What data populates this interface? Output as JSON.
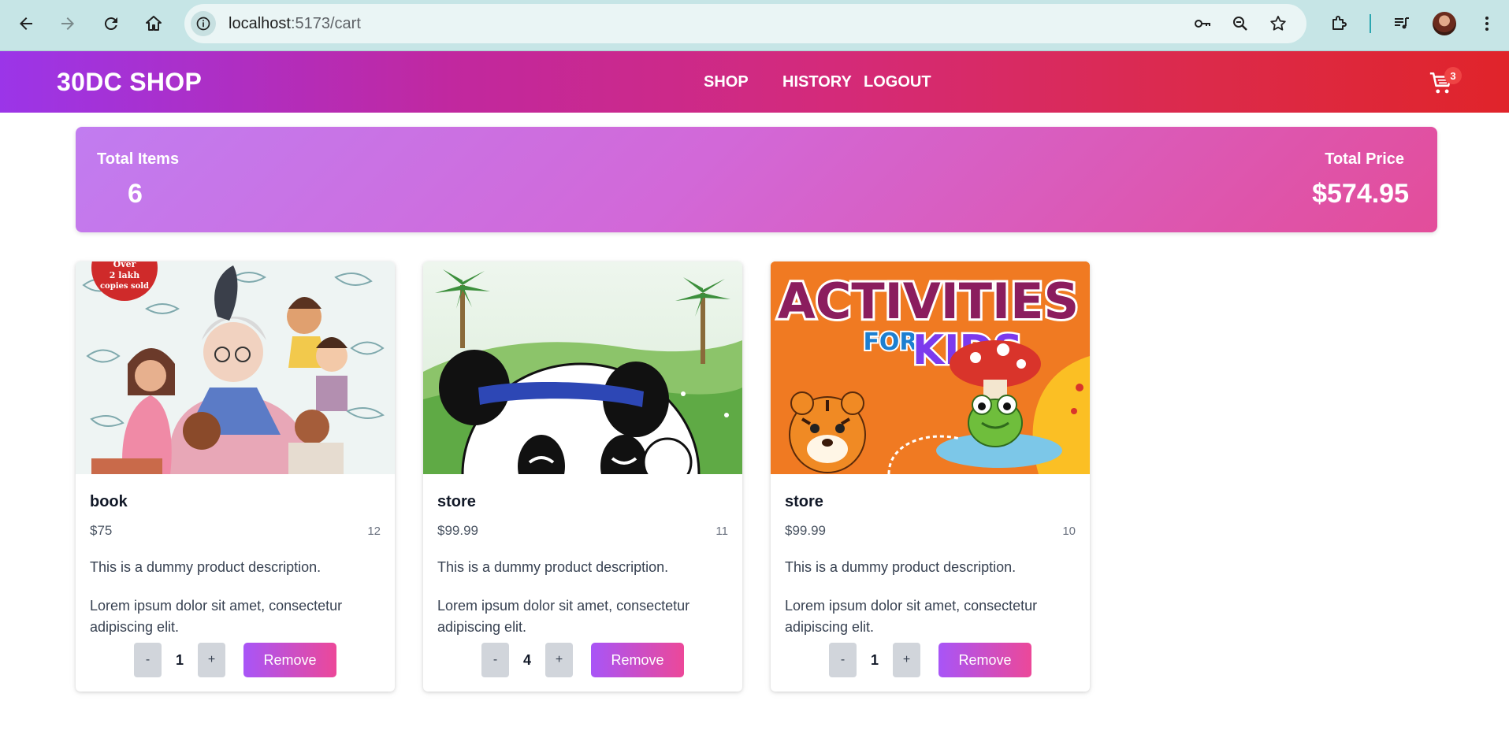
{
  "browser": {
    "url_host": "localhost",
    "url_path": ":5173/cart"
  },
  "header": {
    "brand": "30DC SHOP",
    "nav": [
      {
        "label": "SHOP"
      },
      {
        "label": "HISTORY"
      },
      {
        "label": "LOGOUT"
      }
    ],
    "cart_count": "3"
  },
  "summary": {
    "total_items_label": "Total Items",
    "total_items": "6",
    "total_price_label": "Total Price",
    "total_price": "$574.95"
  },
  "products": [
    {
      "name": "book",
      "price": "$75",
      "stock": "12",
      "description": "This is a dummy product description.",
      "lorem": "Lorem ipsum dolor sit amet, consectetur adipiscing elit.",
      "quantity": "1",
      "minus": "-",
      "plus": "+",
      "remove": "Remove",
      "badge_line1": "Over",
      "badge_line2": "2 lakh",
      "badge_line3": "copies sold"
    },
    {
      "name": "store",
      "price": "$99.99",
      "stock": "11",
      "description": "This is a dummy product description.",
      "lorem": "Lorem ipsum dolor sit amet, consectetur adipiscing elit.",
      "quantity": "4",
      "minus": "-",
      "plus": "+",
      "remove": "Remove"
    },
    {
      "name": "store",
      "price": "$99.99",
      "stock": "10",
      "description": "This is a dummy product description.",
      "lorem": "Lorem ipsum dolor sit amet, consectetur adipiscing elit.",
      "quantity": "1",
      "minus": "-",
      "plus": "+",
      "remove": "Remove",
      "cover_title": "ACTIVITIES",
      "cover_for": "FOR",
      "cover_kids": "KIDS"
    }
  ],
  "colors": {
    "header_start": "#9b35e8",
    "header_end": "#e0242a",
    "summary_start": "#c17cf0",
    "summary_end": "#e34d9a",
    "remove_start": "#a855f7",
    "remove_end": "#ec4899",
    "badge": "#ef4444"
  },
  "icons": [
    "back-icon",
    "forward-icon",
    "reload-icon",
    "home-icon",
    "site-info-icon",
    "password-key-icon",
    "zoom-icon",
    "bookmark-star-icon",
    "extensions-icon",
    "media-icon",
    "profile-avatar",
    "menu-dots-icon",
    "cart-icon"
  ]
}
